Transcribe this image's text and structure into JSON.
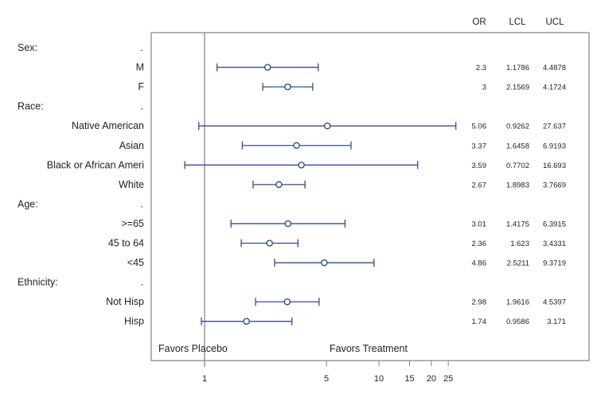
{
  "chart_data": {
    "type": "forest",
    "title": "",
    "xlabel": "",
    "xscale": "log",
    "xlim": [
      0.72,
      28
    ],
    "reference_line": 1,
    "xticks": [
      1,
      5,
      10,
      15,
      20,
      25
    ],
    "xtick_labels": [
      "1",
      "5",
      "10",
      "15",
      "20",
      "25"
    ],
    "annotations": {
      "left": "Favors Placebo",
      "right": "Favors Treatment"
    },
    "columns": [
      "OR",
      "LCL",
      "UCL"
    ],
    "rows": [
      {
        "label": "Sex:",
        "group": true,
        "dot": "."
      },
      {
        "label": "M",
        "or": 2.3,
        "lcl": 1.1786,
        "ucl": 4.4878,
        "or_text": "2.3",
        "lcl_text": "1.1786",
        "ucl_text": "4.4878"
      },
      {
        "label": "F",
        "or": 3,
        "lcl": 2.1569,
        "ucl": 4.1724,
        "or_text": "3",
        "lcl_text": "2.1569",
        "ucl_text": "4.1724"
      },
      {
        "label": "Race:",
        "group": true,
        "dot": "."
      },
      {
        "label": "Native American",
        "or": 5.06,
        "lcl": 0.9262,
        "ucl": 27.637,
        "or_text": "5.06",
        "lcl_text": "0.9262",
        "ucl_text": "27.637"
      },
      {
        "label": "Asian",
        "or": 3.37,
        "lcl": 1.6458,
        "ucl": 6.9193,
        "or_text": "3.37",
        "lcl_text": "1.6458",
        "ucl_text": "6.9193"
      },
      {
        "label": "Black or African Ameri",
        "or": 3.59,
        "lcl": 0.7702,
        "ucl": 16.693,
        "or_text": "3.59",
        "lcl_text": "0.7702",
        "ucl_text": "16.693"
      },
      {
        "label": "White",
        "or": 2.67,
        "lcl": 1.8983,
        "ucl": 3.7669,
        "or_text": "2.67",
        "lcl_text": "1.8983",
        "ucl_text": "3.7669"
      },
      {
        "label": "Age:",
        "group": true,
        "dot": "."
      },
      {
        "label": ">=65",
        "or": 3.01,
        "lcl": 1.4175,
        "ucl": 6.3915,
        "or_text": "3.01",
        "lcl_text": "1.4175",
        "ucl_text": "6.3915"
      },
      {
        "label": "45 to 64",
        "or": 2.36,
        "lcl": 1.623,
        "ucl": 3.4331,
        "or_text": "2.36",
        "lcl_text": "1.623",
        "ucl_text": "3.4331"
      },
      {
        "label": "<45",
        "or": 4.86,
        "lcl": 2.5211,
        "ucl": 9.3719,
        "or_text": "4.86",
        "lcl_text": "2.5211",
        "ucl_text": "9.3719"
      },
      {
        "label": "Ethnicity:",
        "group": true,
        "dot": "."
      },
      {
        "label": "Not Hisp",
        "or": 2.98,
        "lcl": 1.9616,
        "ucl": 4.5397,
        "or_text": "2.98",
        "lcl_text": "1.9616",
        "ucl_text": "4.5397"
      },
      {
        "label": "Hisp",
        "or": 1.74,
        "lcl": 0.9586,
        "ucl": 3.171,
        "or_text": "1.74",
        "lcl_text": "0.9586",
        "ucl_text": "3.171"
      }
    ],
    "colors": {
      "marker": "#2f4f8f",
      "frame": "#808080",
      "text": "#222222"
    }
  }
}
